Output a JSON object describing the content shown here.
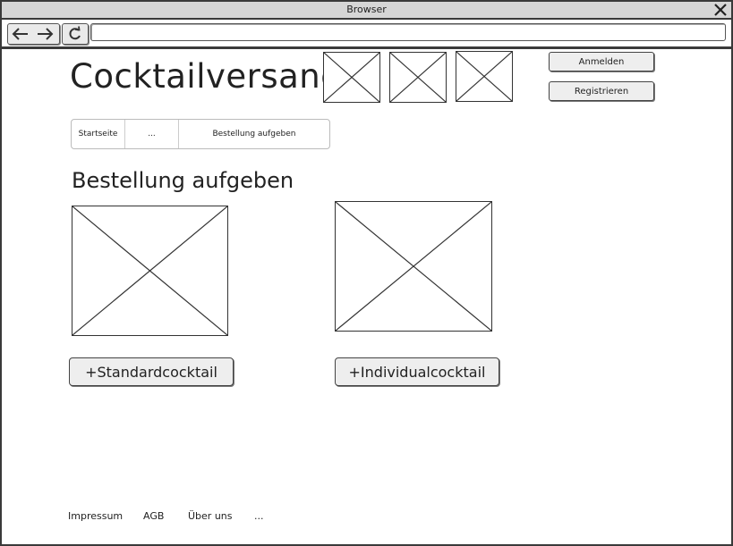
{
  "window": {
    "title": "Browser",
    "url": ""
  },
  "header": {
    "logo_text": "Cocktailversand",
    "login_label": "Anmelden",
    "register_label": "Registrieren"
  },
  "breadcrumb": {
    "items": [
      "Startseite",
      "...",
      "Bestellung aufgeben"
    ]
  },
  "main": {
    "heading": "Bestellung aufgeben",
    "standard_button_label": "+Standardcocktail",
    "individual_button_label": "+Individualcocktail"
  },
  "footer": {
    "links": [
      "Impressum",
      "AGB",
      "Über uns",
      "..."
    ]
  },
  "icons": {
    "back": "back-arrow-icon",
    "forward": "forward-arrow-icon",
    "reload": "reload-icon",
    "close": "close-icon",
    "placeholder": "image-placeholder-icon"
  }
}
